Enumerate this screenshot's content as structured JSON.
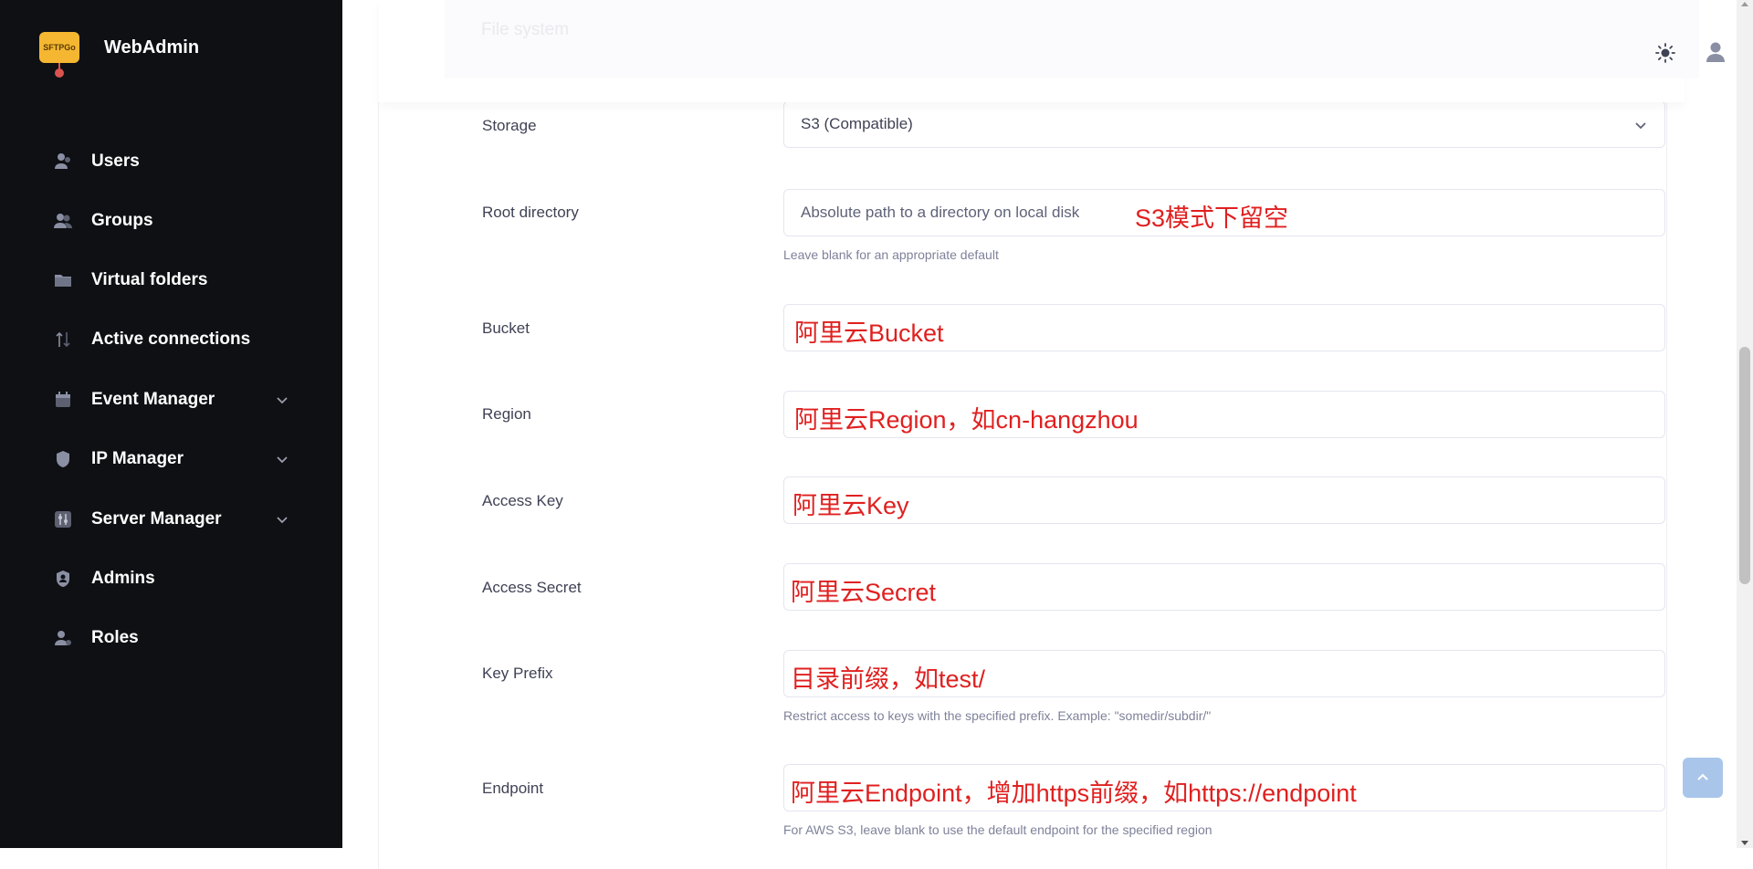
{
  "brand": {
    "logo_text": "SFTPGo",
    "name": "WebAdmin"
  },
  "sidebar": {
    "items": [
      {
        "label": "Users"
      },
      {
        "label": "Groups"
      },
      {
        "label": "Virtual folders"
      },
      {
        "label": "Active connections"
      },
      {
        "label": "Event Manager"
      },
      {
        "label": "IP Manager"
      },
      {
        "label": "Server Manager"
      },
      {
        "label": "Admins"
      },
      {
        "label": "Roles"
      }
    ]
  },
  "header": {
    "ghost_title": "File system"
  },
  "form": {
    "storage": {
      "label": "Storage",
      "value": "S3 (Compatible)"
    },
    "root_directory": {
      "label": "Root directory",
      "placeholder": "Absolute path to a directory on local disk",
      "note": "S3模式下留空",
      "help": "Leave blank for an appropriate default"
    },
    "bucket": {
      "label": "Bucket",
      "note": "阿里云Bucket"
    },
    "region": {
      "label": "Region",
      "note": "阿里云Region，如cn-hangzhou"
    },
    "access_key": {
      "label": "Access Key",
      "note": "阿里云Key"
    },
    "access_secret": {
      "label": "Access Secret",
      "note": "阿里云Secret"
    },
    "key_prefix": {
      "label": "Key Prefix",
      "note": "目录前缀，如test/",
      "help": "Restrict access to keys with the specified prefix. Example: \"somedir/subdir/\""
    },
    "endpoint": {
      "label": "Endpoint",
      "note": "阿里云Endpoint，增加https前缀，如https://endpoint",
      "help": "For AWS S3, leave blank to use the default endpoint for the specified region"
    }
  },
  "colors": {
    "sidebar_bg": "#0f1014",
    "annotation_red": "#e02020",
    "icon_gray": "#8a8fa3",
    "scroll_top_bg": "#a9c6ea"
  },
  "icons": {
    "theme": "sun-icon",
    "user": "user-icon",
    "scroll_top": "arrow-up-icon"
  }
}
